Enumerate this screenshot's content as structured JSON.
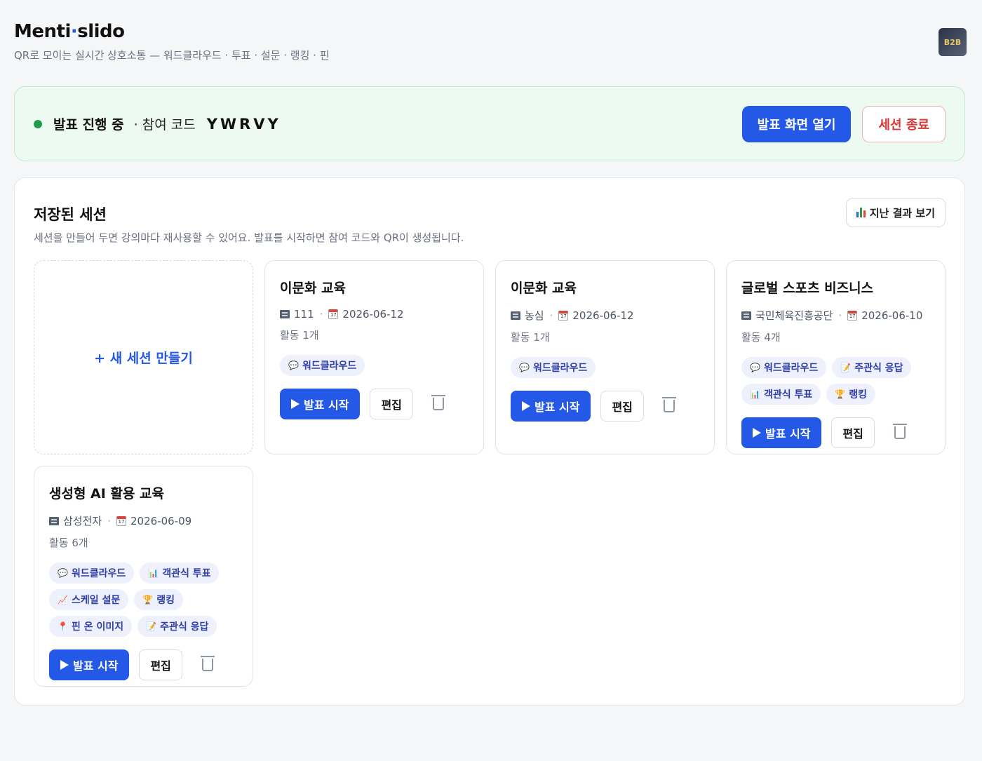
{
  "header": {
    "brand_left": "Menti",
    "brand_dot": "·",
    "brand_right": "slido",
    "tagline": "QR로 모이는 실시간 상호소통 — 워드클라우드 · 투표 · 설문 · 랭킹 · 핀",
    "avatar_text": "B2B"
  },
  "live": {
    "status": "발표 진행 중",
    "code_label": "· 참여 코드",
    "code": "YWRVY",
    "open_button": "발표 화면 열기",
    "end_button": "세션 종료",
    "status_color": "#1f9d4f"
  },
  "sessions": {
    "title": "저장된 세션",
    "description": "세션을 만들어 두면 강의마다 재사용할 수 있어요. 발표를 시작하면 참여 코드와 QR이 생성됩니다.",
    "history_button": "지난 결과 보기",
    "new_session": "+ 새 세션 만들기",
    "start_label": "발표 시작",
    "edit_label": "편집",
    "items": [
      {
        "title": "이문화 교육",
        "org": "111",
        "date": "2026-06-12",
        "count": "활동 1개",
        "chips": [
          {
            "icon": "💬",
            "label": "워드클라우드"
          }
        ]
      },
      {
        "title": "이문화 교육",
        "org": "농심",
        "date": "2026-06-12",
        "count": "활동 1개",
        "chips": [
          {
            "icon": "💬",
            "label": "워드클라우드"
          }
        ]
      },
      {
        "title": "글로벌 스포츠 비즈니스",
        "org": "국민체육진흥공단",
        "date": "2026-06-10",
        "count": "활동 4개",
        "chips": [
          {
            "icon": "💬",
            "label": "워드클라우드"
          },
          {
            "icon": "📝",
            "label": "주관식 응답"
          },
          {
            "icon": "📊",
            "label": "객관식 투표"
          },
          {
            "icon": "🏆",
            "label": "랭킹"
          }
        ]
      },
      {
        "title": "생성형 AI 활용 교육",
        "org": "삼성전자",
        "date": "2026-06-09",
        "count": "활동 6개",
        "chips": [
          {
            "icon": "💬",
            "label": "워드클라우드"
          },
          {
            "icon": "📊",
            "label": "객관식 투표"
          },
          {
            "icon": "📈",
            "label": "스케일 설문"
          },
          {
            "icon": "🏆",
            "label": "랭킹"
          },
          {
            "icon": "📍",
            "label": "핀 온 이미지"
          },
          {
            "icon": "📝",
            "label": "주관식 응답"
          }
        ]
      }
    ]
  },
  "colors": {
    "accent": "#2458e6",
    "danger": "#d93838",
    "live_bg": "#ecfaf1"
  }
}
